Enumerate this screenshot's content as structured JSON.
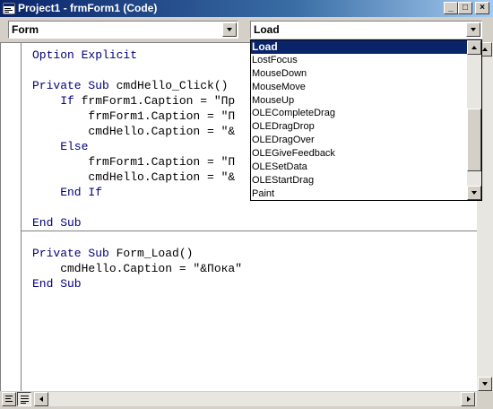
{
  "window": {
    "title": "Project1 - frmForm1 (Code)",
    "minimize": "_",
    "maximize": "□",
    "close": "×"
  },
  "object_combo": {
    "value": "Form"
  },
  "procedure_combo": {
    "value": "Load"
  },
  "code": {
    "lines": [
      [
        {
          "t": "Option Explicit",
          "k": true
        }
      ],
      [],
      [
        {
          "t": "Private Sub ",
          "k": true
        },
        {
          "t": "cmdHello_Click()",
          "k": false
        }
      ],
      [
        {
          "t": "    If ",
          "k": true
        },
        {
          "t": "frmForm1.Caption = \"Пр",
          "k": false
        }
      ],
      [
        {
          "t": "        frmForm1.Caption = \"П",
          "k": false
        }
      ],
      [
        {
          "t": "        cmdHello.Caption = \"&",
          "k": false
        }
      ],
      [
        {
          "t": "    Else",
          "k": true
        }
      ],
      [
        {
          "t": "        frmForm1.Caption = \"П",
          "k": false
        }
      ],
      [
        {
          "t": "        cmdHello.Caption = \"&",
          "k": false
        }
      ],
      [
        {
          "t": "    End If",
          "k": true
        }
      ],
      [],
      [
        {
          "t": "End Sub",
          "k": true
        }
      ],
      [],
      [
        {
          "t": "Private Sub ",
          "k": true
        },
        {
          "t": "Form_Load()",
          "k": false
        }
      ],
      [
        {
          "t": "    cmdHello.Caption = \"&Пока\"",
          "k": false
        }
      ],
      [
        {
          "t": "End Sub",
          "k": true
        }
      ]
    ]
  },
  "dropdown": {
    "items": [
      "Load",
      "LostFocus",
      "MouseDown",
      "MouseMove",
      "MouseUp",
      "OLECompleteDrag",
      "OLEDragDrop",
      "OLEDragOver",
      "OLEGiveFeedback",
      "OLESetData",
      "OLEStartDrag",
      "Paint"
    ],
    "selected_index": 0
  },
  "colors": {
    "keyword": "#00007f",
    "selection": "#0a246a",
    "titlebar": "#0a246a"
  },
  "icons": {
    "app": "vb-code-window-icon",
    "view_procedure": "procedure-view-icon",
    "view_full": "full-module-view-icon"
  }
}
